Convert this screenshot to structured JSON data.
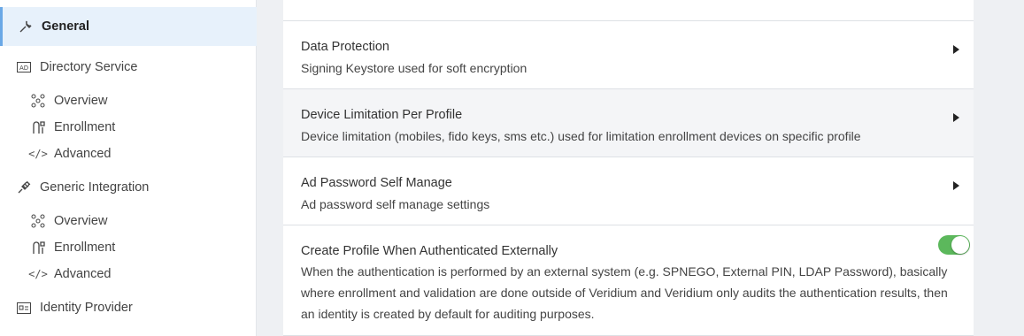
{
  "sidebar": {
    "items": [
      {
        "label": "General",
        "icon": "wrench-icon"
      },
      {
        "label": "Directory Service",
        "icon": "ad-icon"
      },
      {
        "label": "Overview",
        "icon": "network-icon"
      },
      {
        "label": "Enrollment",
        "icon": "enrollment-icon"
      },
      {
        "label": "Advanced",
        "icon": "code-icon"
      },
      {
        "label": "Generic Integration",
        "icon": "plug-icon"
      },
      {
        "label": "Overview",
        "icon": "network-icon"
      },
      {
        "label": "Enrollment",
        "icon": "enrollment-icon"
      },
      {
        "label": "Advanced",
        "icon": "code-icon"
      },
      {
        "label": "Identity Provider",
        "icon": "id-card-icon"
      }
    ]
  },
  "settings": [
    {
      "title": "Data Protection",
      "description": "Signing Keystore used for soft encryption"
    },
    {
      "title": "Device Limitation Per Profile",
      "description": "Device limitation (mobiles, fido keys, sms etc.) used for limitation enrollment devices on specific profile"
    },
    {
      "title": "Ad Password Self Manage",
      "description": "Ad password self manage settings"
    },
    {
      "title": "Create Profile When Authenticated Externally",
      "description": "When the authentication is performed by an external system (e.g. SPNEGO, External PIN, LDAP Password), basically where enrollment and validation are done outside of Veridium and Veridium only audits the authentication results, then an identity is created by default for auditing purposes.",
      "toggle_on": true
    }
  ],
  "colors": {
    "accent": "#6aa8e6",
    "toggle": "#5cb85c",
    "active_bg": "#e7f1fb"
  }
}
